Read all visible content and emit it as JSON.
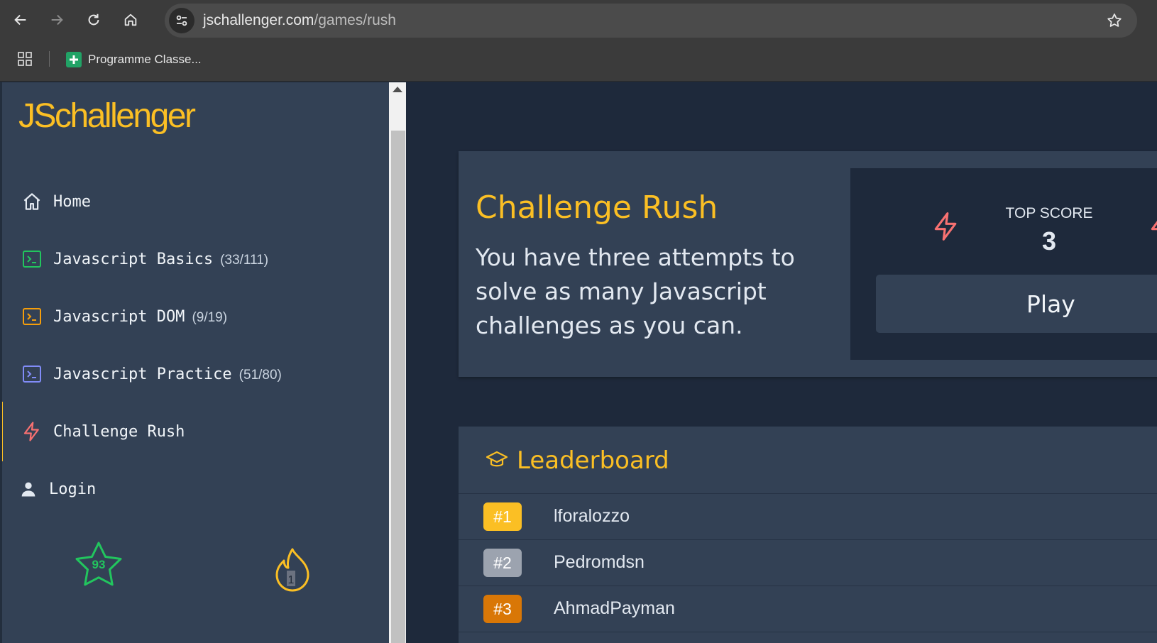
{
  "browser": {
    "url_host": "jschallenger.com",
    "url_path": "/games/rush",
    "bookmark_label": "Programme Classe..."
  },
  "sidebar": {
    "logo": "JSchallenger",
    "items": [
      {
        "label": "Home",
        "count": "",
        "icon": "home-icon"
      },
      {
        "label": "Javascript Basics",
        "count": "(33/111)",
        "icon": "terminal-icon",
        "color": "#22c55e"
      },
      {
        "label": "Javascript DOM",
        "count": "(9/19)",
        "icon": "terminal-icon",
        "color": "#f59e0b"
      },
      {
        "label": "Javascript Practice",
        "count": "(51/80)",
        "icon": "terminal-icon",
        "color": "#818cf8"
      },
      {
        "label": "Challenge Rush",
        "count": "",
        "icon": "bolt-icon",
        "color": "#f87171",
        "active": true
      },
      {
        "label": "Login",
        "count": "",
        "icon": "user-icon"
      }
    ],
    "stars_count": "93",
    "streak_count": "1"
  },
  "rush": {
    "title": "Challenge Rush",
    "description": "You have three attempts to solve as many Javascript challenges as you can.",
    "top_score_label": "TOP SCORE",
    "top_score_value": "3",
    "play_label": "Play"
  },
  "leaderboard": {
    "title": "Leaderboard",
    "rows": [
      {
        "rank": "#1",
        "name": "lforalozzo",
        "color": "#fbbf24"
      },
      {
        "rank": "#2",
        "name": "Pedromdsn",
        "color": "#9ca3af"
      },
      {
        "rank": "#3",
        "name": "AhmadPayman",
        "color": "#d97706"
      }
    ]
  },
  "colors": {
    "accent": "#fbbf24",
    "sidebar_bg": "#334155",
    "main_bg": "#1e293b"
  }
}
